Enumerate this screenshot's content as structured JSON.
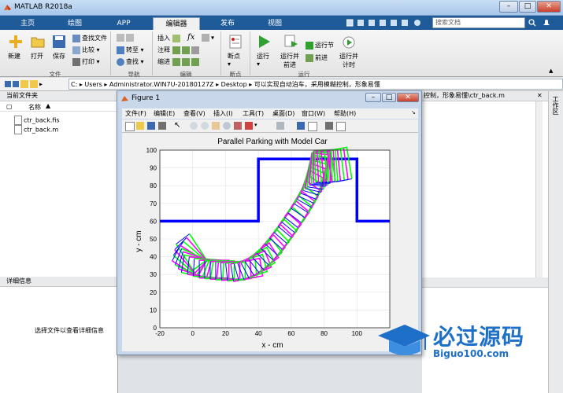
{
  "app": {
    "title": "MATLAB R2018a"
  },
  "tabs": [
    "主页",
    "绘图",
    "APP",
    "编辑器",
    "发布",
    "视图"
  ],
  "search": {
    "placeholder": "搜索文档"
  },
  "ribbon": {
    "file": {
      "new": "新建",
      "open": "打开",
      "save": "保存",
      "find_files": "查找文件",
      "compare": "比较",
      "print": "打印",
      "group": "文件"
    },
    "nav": {
      "goto": "转至",
      "find": "查找",
      "group": "导航"
    },
    "edit": {
      "insert": "插入",
      "fx": "fx",
      "comment": "注释",
      "indent": "缩进",
      "group": "编辑"
    },
    "breakpoints": {
      "label": "断点",
      "group": "断点"
    },
    "run": {
      "run": "运行",
      "run_advance": "运行并\n前进",
      "run_section": "运行节",
      "advance": "前进",
      "run_time": "运行并\n计时",
      "group": "运行"
    }
  },
  "address": {
    "segments": [
      "C:",
      "Users",
      "Administrator.WIN7U-20180127Z",
      "Desktop",
      "可以实现自动泊车，采用模糊控制，形象易懂"
    ]
  },
  "left": {
    "header": "当前文件夹",
    "col_name": "名称",
    "files": [
      "ctr_back.fis",
      "ctr_back.m"
    ],
    "details_header": "详细信息",
    "details_msg": "选择文件以查看详细信息"
  },
  "editor_tab": {
    "label": "控制，形象易懂\\ctr_back.m"
  },
  "side_label": "工作区",
  "figure": {
    "title": "Figure 1",
    "menu": [
      "文件(F)",
      "编辑(E)",
      "查看(V)",
      "插入(I)",
      "工具(T)",
      "桌面(D)",
      "窗口(W)",
      "帮助(H)"
    ]
  },
  "watermark": {
    "text": "必过源码",
    "sub": "Biguo100.com"
  },
  "colors": {
    "wall": "#0000ff",
    "car_a": "#00ff00",
    "car_b": "#ff00ff",
    "rear": "#0000ff"
  },
  "chart_data": {
    "type": "line",
    "title": "Parallel Parking with Model Car",
    "xlabel": "x - cm",
    "ylabel": "y - cm",
    "xlim": [
      -20,
      120
    ],
    "ylim": [
      0,
      100
    ],
    "xticks": [
      -20,
      0,
      20,
      40,
      60,
      80,
      100
    ],
    "yticks": [
      0,
      10,
      20,
      30,
      40,
      50,
      60,
      70,
      80,
      90,
      100
    ],
    "grid": true,
    "boundary": {
      "x": [
        -20,
        40,
        40,
        100,
        100,
        120
      ],
      "y": [
        60,
        60,
        95,
        95,
        60,
        60
      ]
    }
  }
}
